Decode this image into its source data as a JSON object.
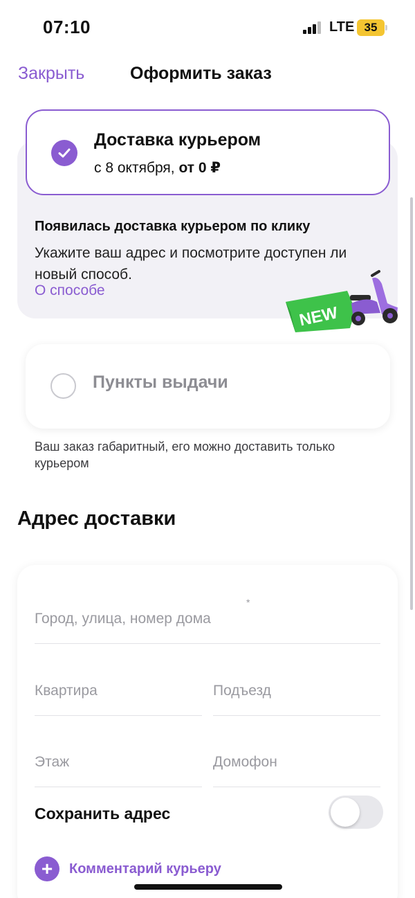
{
  "status_bar": {
    "time": "07:10",
    "network": "LTE",
    "battery": "35"
  },
  "header": {
    "close_label": "Закрыть",
    "title": "Оформить заказ"
  },
  "delivery_options": {
    "courier": {
      "title": "Доставка курьером",
      "date_text": "с 8 октября, ",
      "price_text": "от 0 ₽",
      "selected": true
    },
    "promo": {
      "title": "Появилась доставка курьером по клику",
      "text": "Укажите ваш адрес и посмотрите доступен ли новый способ.",
      "link": "О способе",
      "badge": "NEW"
    },
    "pickup": {
      "title": "Пункты выдачи",
      "selected": false,
      "note": "Ваш заказ габаритный, его можно доставить только курьером"
    }
  },
  "address": {
    "section_title": "Адрес доставки",
    "street_placeholder": "Город, улица, номер дома",
    "required_mark": "*",
    "apartment_placeholder": "Квартира",
    "entrance_placeholder": "Подъезд",
    "floor_placeholder": "Этаж",
    "intercom_placeholder": "Домофон",
    "save_label": "Сохранить адрес",
    "save_enabled": false,
    "comment_label": "Комментарий курьеру"
  },
  "colors": {
    "accent": "#8a5cd1",
    "promo_green": "#3ec24a",
    "battery": "#f4c531"
  }
}
